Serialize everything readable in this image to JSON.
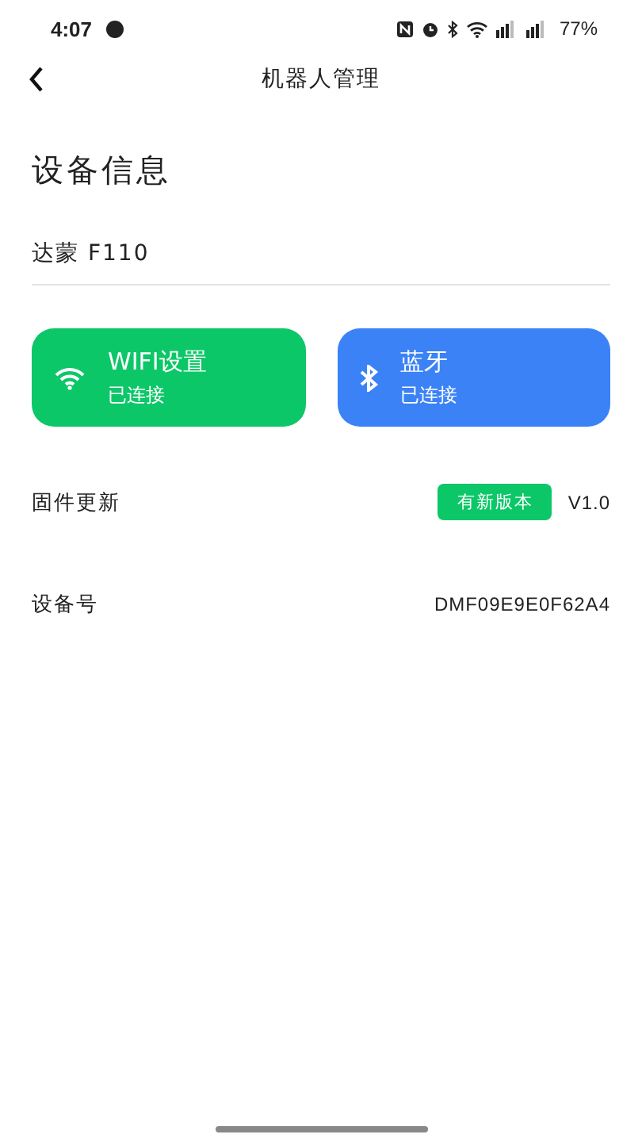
{
  "status_bar": {
    "time": "4:07",
    "battery": "77%"
  },
  "header": {
    "title": "机器人管理"
  },
  "section_title": "设备信息",
  "device_name": "达蒙 F110",
  "cards": [
    {
      "kind": "wifi",
      "title": "WIFI设置",
      "status": "已连接",
      "color": "#0cc768"
    },
    {
      "kind": "bluetooth",
      "title": "蓝牙",
      "status": "已连接",
      "color": "#3b82f6"
    }
  ],
  "firmware": {
    "label": "固件更新",
    "badge": "有新版本",
    "version": "V1.0"
  },
  "device_id": {
    "label": "设备号",
    "value": "DMF09E9E0F62A4"
  }
}
